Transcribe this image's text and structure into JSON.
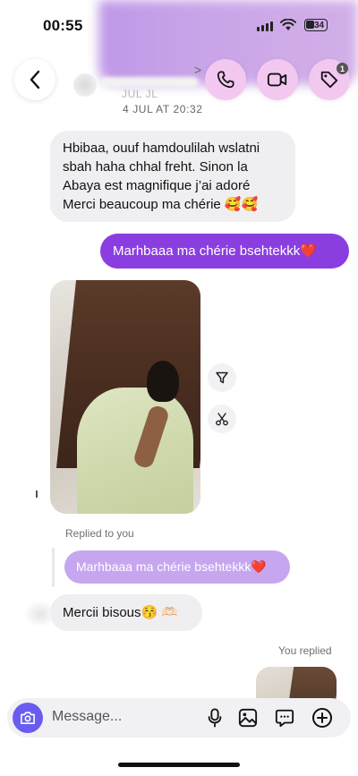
{
  "status_bar": {
    "time": "00:55",
    "battery": "34"
  },
  "header": {
    "badge_count": "1",
    "date_ghost": "JUL JL",
    "date_label": "4 JUL AT 20:32"
  },
  "messages": {
    "received_1": "Hbibaa, ouuf hamdoulilah wslatni sbah haha chhal freht. Sinon la Abaya est magnifique j’ai adoré Merci beaucoup ma chérie 🥰🥰",
    "sent_1": "Marhbaaa ma chérie bsehtekkk❤️",
    "replied_to_label": "Replied to you",
    "quoted_text": "Marhbaaa ma chérie bsehtekkk❤️",
    "received_2": "Mercii bisous😚 🫶🏻",
    "you_replied_label": "You replied"
  },
  "composer": {
    "placeholder": "Message..."
  },
  "colors": {
    "sent_bubble": "#8a3ee0",
    "quote_bubble": "#c7a6f0",
    "received_bubble": "#efeff1",
    "header_button": "#f3c8f0",
    "camera_button": "#6a5cf0"
  },
  "icons": {
    "back": "chevron-left-icon",
    "call": "phone-icon",
    "video": "video-camera-icon",
    "tag": "tag-icon",
    "filter": "filter-icon",
    "scissors": "scissors-icon",
    "camera": "camera-icon",
    "mic": "microphone-icon",
    "gallery": "gallery-icon",
    "sticker": "sticker-icon",
    "plus": "plus-icon"
  }
}
